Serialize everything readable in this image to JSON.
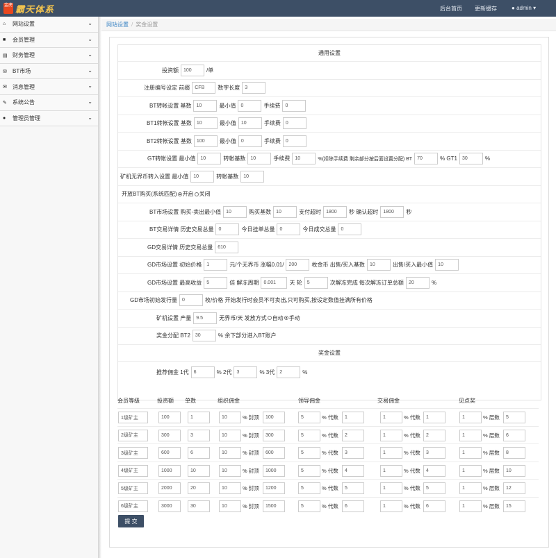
{
  "header": {
    "logo_badge": "金虎",
    "logo_text": "霸天体系",
    "links": [
      "后台首页",
      "更新缓存",
      "admin"
    ]
  },
  "sidebar": {
    "items": [
      {
        "icon": "home-icon",
        "label": "网站设置"
      },
      {
        "icon": "users-icon",
        "label": "会员管理"
      },
      {
        "icon": "finance-icon",
        "label": "财务管理"
      },
      {
        "icon": "market-icon",
        "label": "BT市场"
      },
      {
        "icon": "message-icon",
        "label": "消息管理"
      },
      {
        "icon": "announce-icon",
        "label": "系统公告"
      },
      {
        "icon": "admin-icon",
        "label": "管理员管理"
      }
    ]
  },
  "breadcrumb": {
    "root": "网站设置",
    "current": "奖金设置"
  },
  "general": {
    "title": "通用设置",
    "invest": {
      "label": "投资额",
      "value": "100",
      "unit": "/单"
    },
    "regnum": {
      "label": "注册编号设定 前缀",
      "prefix": "CFB",
      "digits_label": "数字长度",
      "digits": "3"
    },
    "bt": {
      "label": "BT转帐设置 基数",
      "base": "10",
      "min_label": "最小值",
      "min": "0",
      "fee_label": "手续费",
      "fee": "0"
    },
    "bt1": {
      "label": "BT1转帐设置 基数",
      "base": "10",
      "min_label": "最小值",
      "min": "10",
      "fee_label": "手续费",
      "fee": "0"
    },
    "bt2": {
      "label": "BT2转帐设置 基数",
      "base": "100",
      "min_label": "最小值",
      "min": "0",
      "fee_label": "手续费",
      "fee": "0"
    },
    "gt": {
      "label": "GT转帐设置 最小值",
      "min": "10",
      "base_label": "转帐基数",
      "base": "10",
      "fee_label": "手续费",
      "fee": "10",
      "desc": "%(扣除手续费 剩余部分按后面设置分配) BT",
      "bt": "70",
      "gt1_label": "% GT1",
      "gt1": "30",
      "pct": "%"
    },
    "miner": {
      "label": "矿机无界币转入设置 最小值",
      "min": "10",
      "base_label": "转帐基数",
      "base": "10"
    },
    "btbuy": {
      "label": "开放BT购买(系统匹配)",
      "on": "开启",
      "off": "关闭"
    },
    "btmarket": {
      "label": "BT市场设置 购买-卖出最小值",
      "min": "10",
      "base_label": "购买基数",
      "base": "10",
      "pay_label": "支付超时",
      "pay": "1800",
      "sec1": "秒 确认超时",
      "confirm": "1800",
      "sec2": "秒"
    },
    "bttrade": {
      "label": "BT交易详情 历史交易总量",
      "history": "0",
      "today_label": "今日挂单总量",
      "today": "0",
      "done_label": "今日成交总量",
      "done": "0"
    },
    "gdtrade": {
      "label": "GD交易详情 历史交易总量",
      "history": "610"
    },
    "gdmarket": {
      "label": "GD市场设置 初始价格",
      "price": "1",
      "unit1": "元/个无界币 涨幅0.01/",
      "amount": "200",
      "unit2": "枚金币 出售/买入基数",
      "base": "10",
      "min_label": "出售/买入最小值",
      "min": "10"
    },
    "gdmarket2": {
      "label": "GD市场设置 最高收益",
      "max": "5",
      "unfreeze_label": "倍 解冻周期",
      "cycle": "0.001",
      "days_label": "天 轮",
      "rounds": "5",
      "order_label": "次解冻完成 每次解冻订单总额",
      "order": "20",
      "pct": "%"
    },
    "gdissue": {
      "label": "GD市场初始发行量",
      "amount": "0",
      "desc": "枚/价格 开始发行时会员不可卖出,只可购买,按设定数值挂满所有价格"
    },
    "minerset": {
      "label": "矿机设置 产量",
      "output": "9.5",
      "desc": "无界币/天 发放方式",
      "auto": "自动",
      "manual": "手动"
    },
    "bonus": {
      "label": "奖金分配 BT2",
      "value": "30",
      "desc": "% 余下部分进入BT账户"
    }
  },
  "reward": {
    "title": "奖金设置",
    "label": "推荐佣金 1代",
    "g1": "6",
    "g2_label": "% 2代",
    "g2": "3",
    "g3_label": "% 3代",
    "g3": "2",
    "pct": "%"
  },
  "table": {
    "headers": [
      "会员等级",
      "投资额",
      "单数",
      "组织佣金",
      "领导佣金",
      "交易佣金",
      "见点奖"
    ],
    "pct_cap": "% 封顶",
    "pct_gen": "% 代数",
    "pct_layer": "% 层数",
    "rows": [
      [
        "1级矿主",
        "100",
        "1",
        "10",
        "100",
        "5",
        "1",
        "1",
        "1",
        "1",
        "5"
      ],
      [
        "2级矿主",
        "300",
        "3",
        "10",
        "300",
        "5",
        "2",
        "1",
        "2",
        "1",
        "6"
      ],
      [
        "3级矿主",
        "600",
        "6",
        "10",
        "600",
        "5",
        "3",
        "1",
        "3",
        "1",
        "8"
      ],
      [
        "4级矿主",
        "1000",
        "10",
        "10",
        "1000",
        "5",
        "4",
        "1",
        "4",
        "1",
        "10"
      ],
      [
        "5级矿主",
        "2000",
        "20",
        "10",
        "1200",
        "5",
        "5",
        "1",
        "5",
        "1",
        "12"
      ],
      [
        "6级矿主",
        "3000",
        "30",
        "10",
        "1500",
        "5",
        "6",
        "1",
        "6",
        "1",
        "15"
      ]
    ]
  },
  "submit_label": "提 交"
}
